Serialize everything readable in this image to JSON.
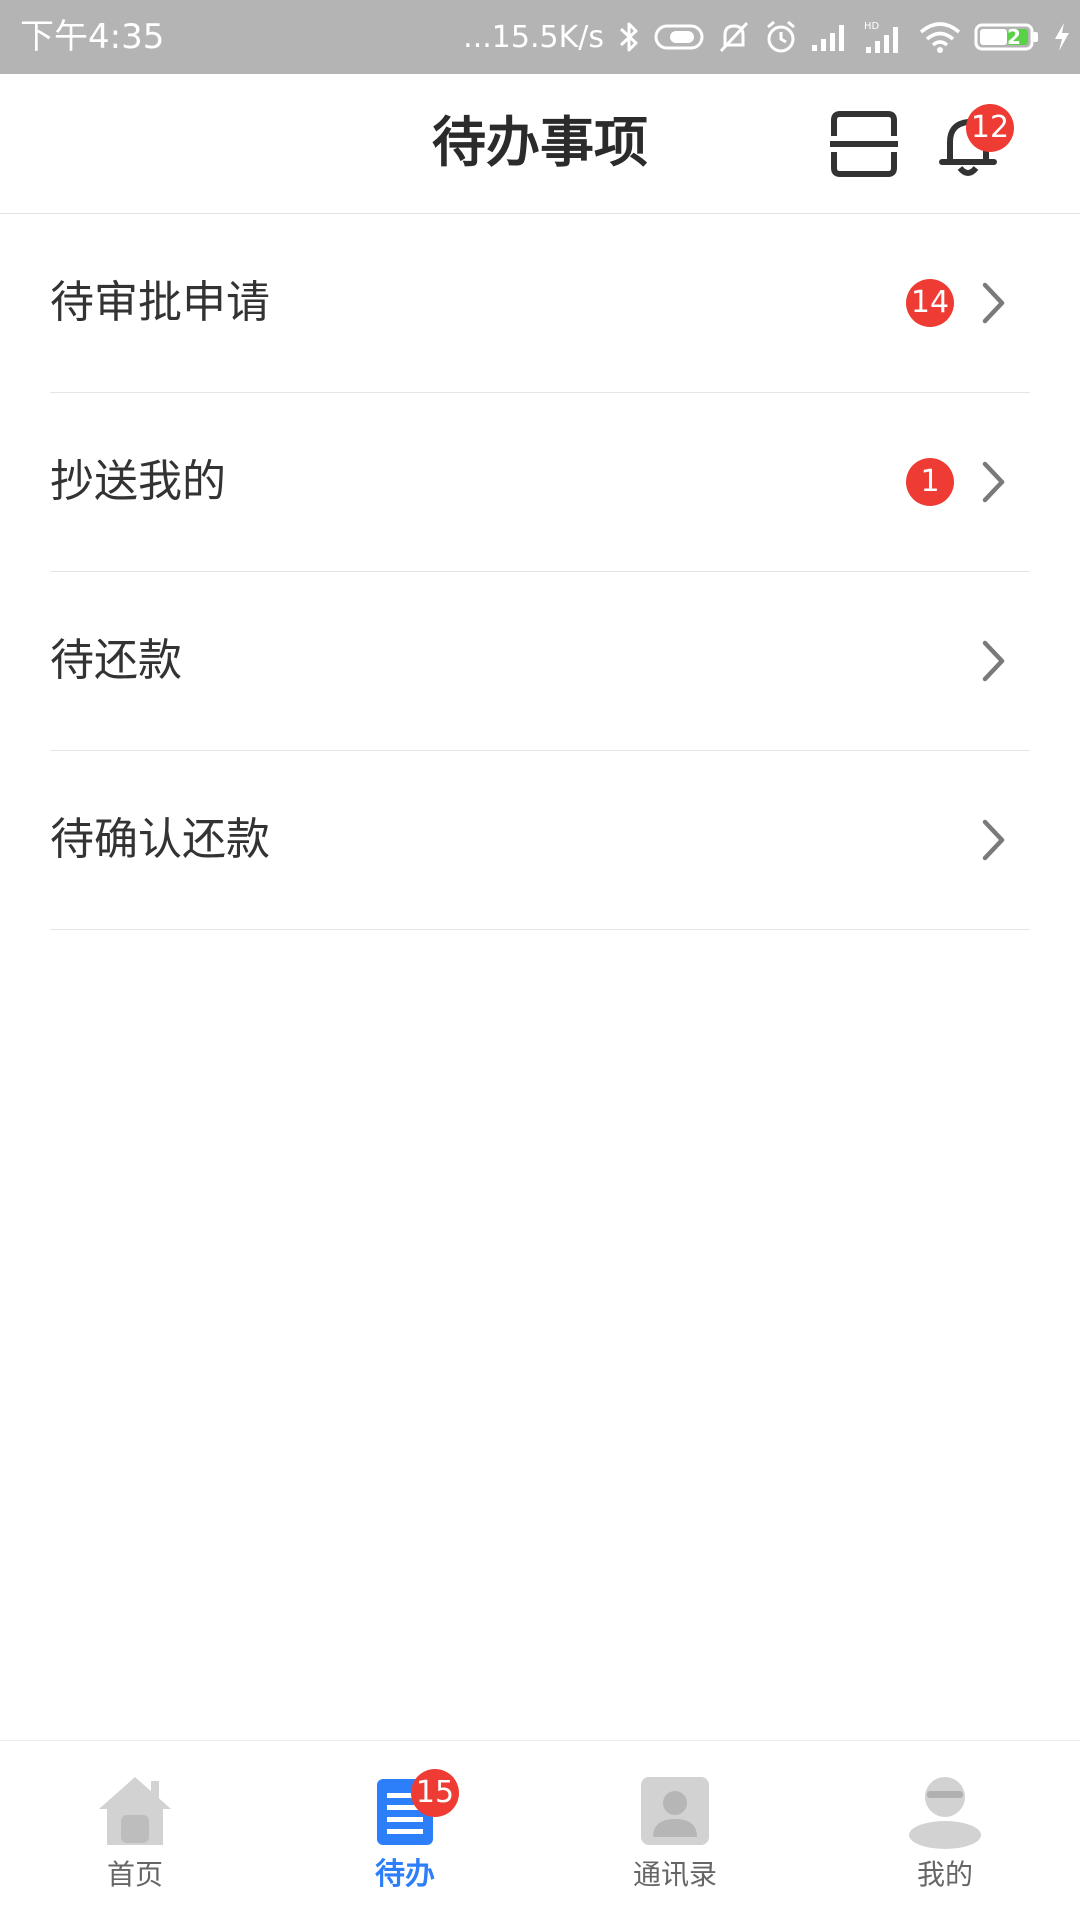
{
  "status_bar": {
    "time": "下午4:35",
    "network_speed": "...15.5K/s",
    "battery_level": "52",
    "icons": [
      "bluetooth-icon",
      "toggle-icon",
      "mute-icon",
      "alarm-icon",
      "signal-icon",
      "hd-signal-icon",
      "wifi-icon",
      "battery-icon",
      "charging-icon"
    ]
  },
  "header": {
    "title": "待办事项",
    "notification_count": "12",
    "icons": [
      "scan-icon",
      "bell-icon"
    ]
  },
  "todo_items": [
    {
      "label": "待审批申请",
      "badge": "14"
    },
    {
      "label": "抄送我的",
      "badge": "1"
    },
    {
      "label": "待还款",
      "badge": ""
    },
    {
      "label": "待确认还款",
      "badge": ""
    }
  ],
  "tabbar": {
    "tabs": [
      {
        "label": "首页",
        "icon": "home-icon",
        "active": false,
        "badge": ""
      },
      {
        "label": "待办",
        "icon": "todo-icon",
        "active": true,
        "badge": "15"
      },
      {
        "label": "通讯录",
        "icon": "contacts-icon",
        "active": false,
        "badge": ""
      },
      {
        "label": "我的",
        "icon": "profile-icon",
        "active": false,
        "badge": ""
      }
    ]
  },
  "colors": {
    "status_bar": "#b4b4b4",
    "badge": "#ee3b33",
    "accent": "#2d7ff9",
    "inactive_icon": "#d2d2d2"
  }
}
